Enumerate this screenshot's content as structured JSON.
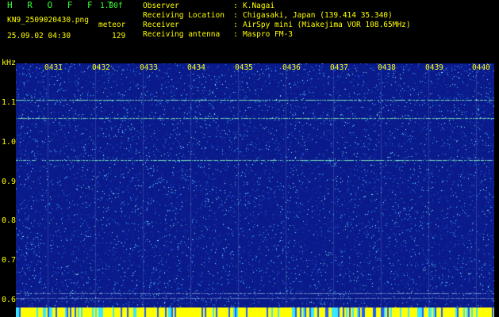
{
  "header": {
    "app_title": "H R O F F T",
    "version": "1.00f",
    "file_name": "KN9_2509020430.png",
    "mode": "meteor",
    "date_time": "25.09.02 04:30",
    "counter": "129"
  },
  "info": [
    {
      "label": "Observer",
      "value": "K.Nagai"
    },
    {
      "label": "Receiving Location",
      "value": "Chigasaki, Japan (139.414 35.340)"
    },
    {
      "label": "Receiver",
      "value": "AirSpy mini (Miakejima VOR 108.65MHz)"
    },
    {
      "label": "Receiving antenna",
      "value": "Maspro FM-3"
    }
  ],
  "spectrogram": {
    "unit_label": "kHz",
    "y_ticks": [
      "1.1",
      "1.0",
      "0.9",
      "0.8",
      "0.7",
      "0.6"
    ],
    "x_ticks": [
      "0431",
      "0432",
      "0433",
      "0434",
      "0435",
      "0436",
      "0437",
      "0438",
      "0439",
      "0440"
    ],
    "colors": {
      "background": "#0a1a8a",
      "noise_low": "#1f5cff",
      "noise_high": "#39e6ff",
      "line": "#7ff0c0",
      "text": "#ffff00"
    }
  }
}
